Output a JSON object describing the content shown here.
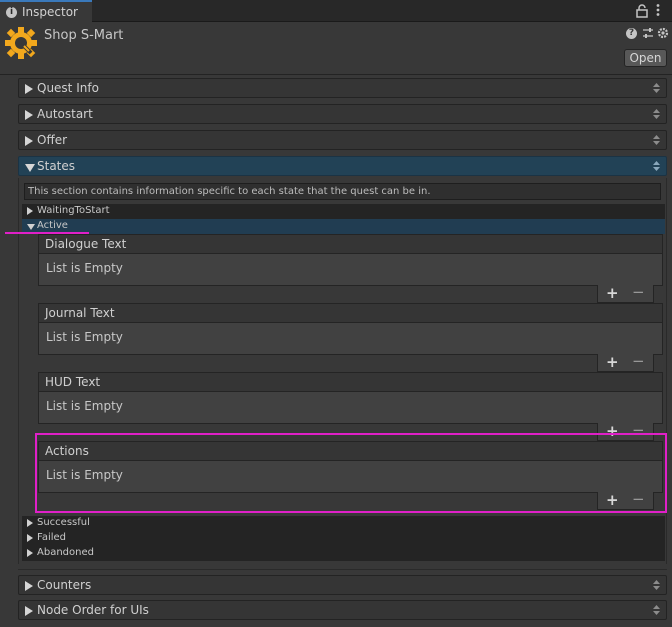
{
  "window": {
    "tab_title": "Inspector",
    "info_icon": "info-icon",
    "lock_icon": "lock-icon",
    "menu_icon": "kebab-menu-icon"
  },
  "header": {
    "object_name": "Shop S-Mart",
    "logo_icon": "quest-machine-logo-icon",
    "open_button": "Open",
    "icons": [
      "help-icon",
      "preset-sliders-icon",
      "gear-icon"
    ]
  },
  "sections": {
    "quest_info": "Quest Info",
    "autostart": "Autostart",
    "offer": "Offer",
    "states": "States",
    "counters": "Counters",
    "node_order": "Node Order for UIs"
  },
  "states": {
    "help_text": "This section contains information specific to each state that the quest can be in.",
    "waiting": "WaitingToStart",
    "active": "Active",
    "successful": "Successful",
    "failed": "Failed",
    "abandoned": "Abandoned"
  },
  "lists": {
    "dialogue": {
      "title": "Dialogue Text",
      "empty": "List is Empty"
    },
    "journal": {
      "title": "Journal Text",
      "empty": "List is Empty"
    },
    "hud": {
      "title": "HUD Text",
      "empty": "List is Empty"
    },
    "actions": {
      "title": "Actions",
      "empty": "List is Empty"
    },
    "add_symbol": "+",
    "remove_symbol": "−"
  },
  "colors": {
    "background": "#383838",
    "selected_bar": "#224256",
    "annotation": "#e020c8"
  }
}
